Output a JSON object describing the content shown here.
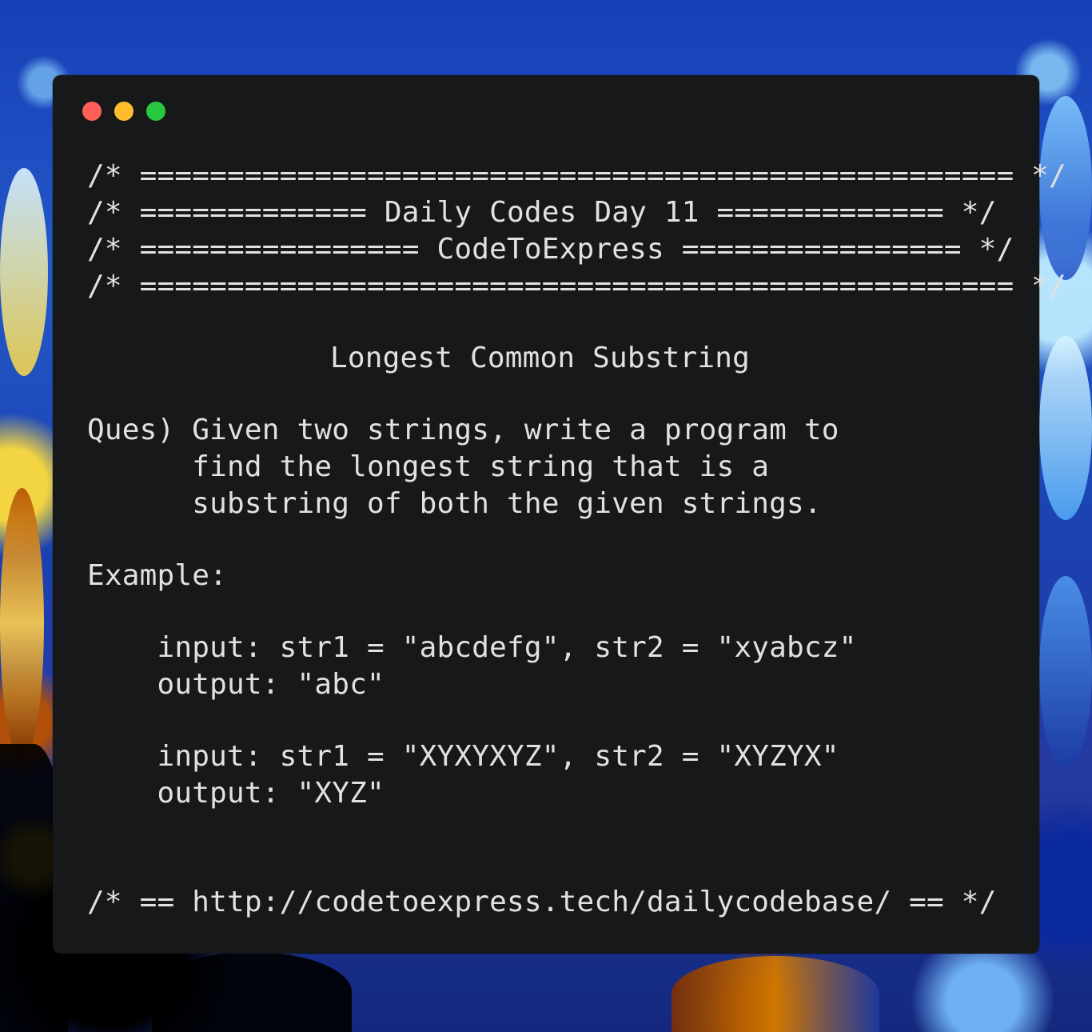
{
  "code": {
    "header_lines": [
      "/* ================================================== */",
      "/* ============= Daily Codes Day 11 ============= */",
      "/* ================ CodeToExpress ================ */",
      "/* ================================================== */"
    ],
    "title": "Longest Common Substring",
    "question": [
      "Ques) Given two strings, write a program to",
      "      find the longest string that is a",
      "      substring of both the given strings."
    ],
    "example_label": "Example:",
    "examples": [
      {
        "input": "    input: str1 = \"abcdefg\", str2 = \"xyabcz\"",
        "output": "    output: \"abc\""
      },
      {
        "input": "    input: str1 = \"XYXYXYZ\", str2 = \"XYZYX\"",
        "output": "    output: \"XYZ\""
      }
    ],
    "footer": "/* == http://codetoexpress.tech/dailycodebase/ == */"
  }
}
